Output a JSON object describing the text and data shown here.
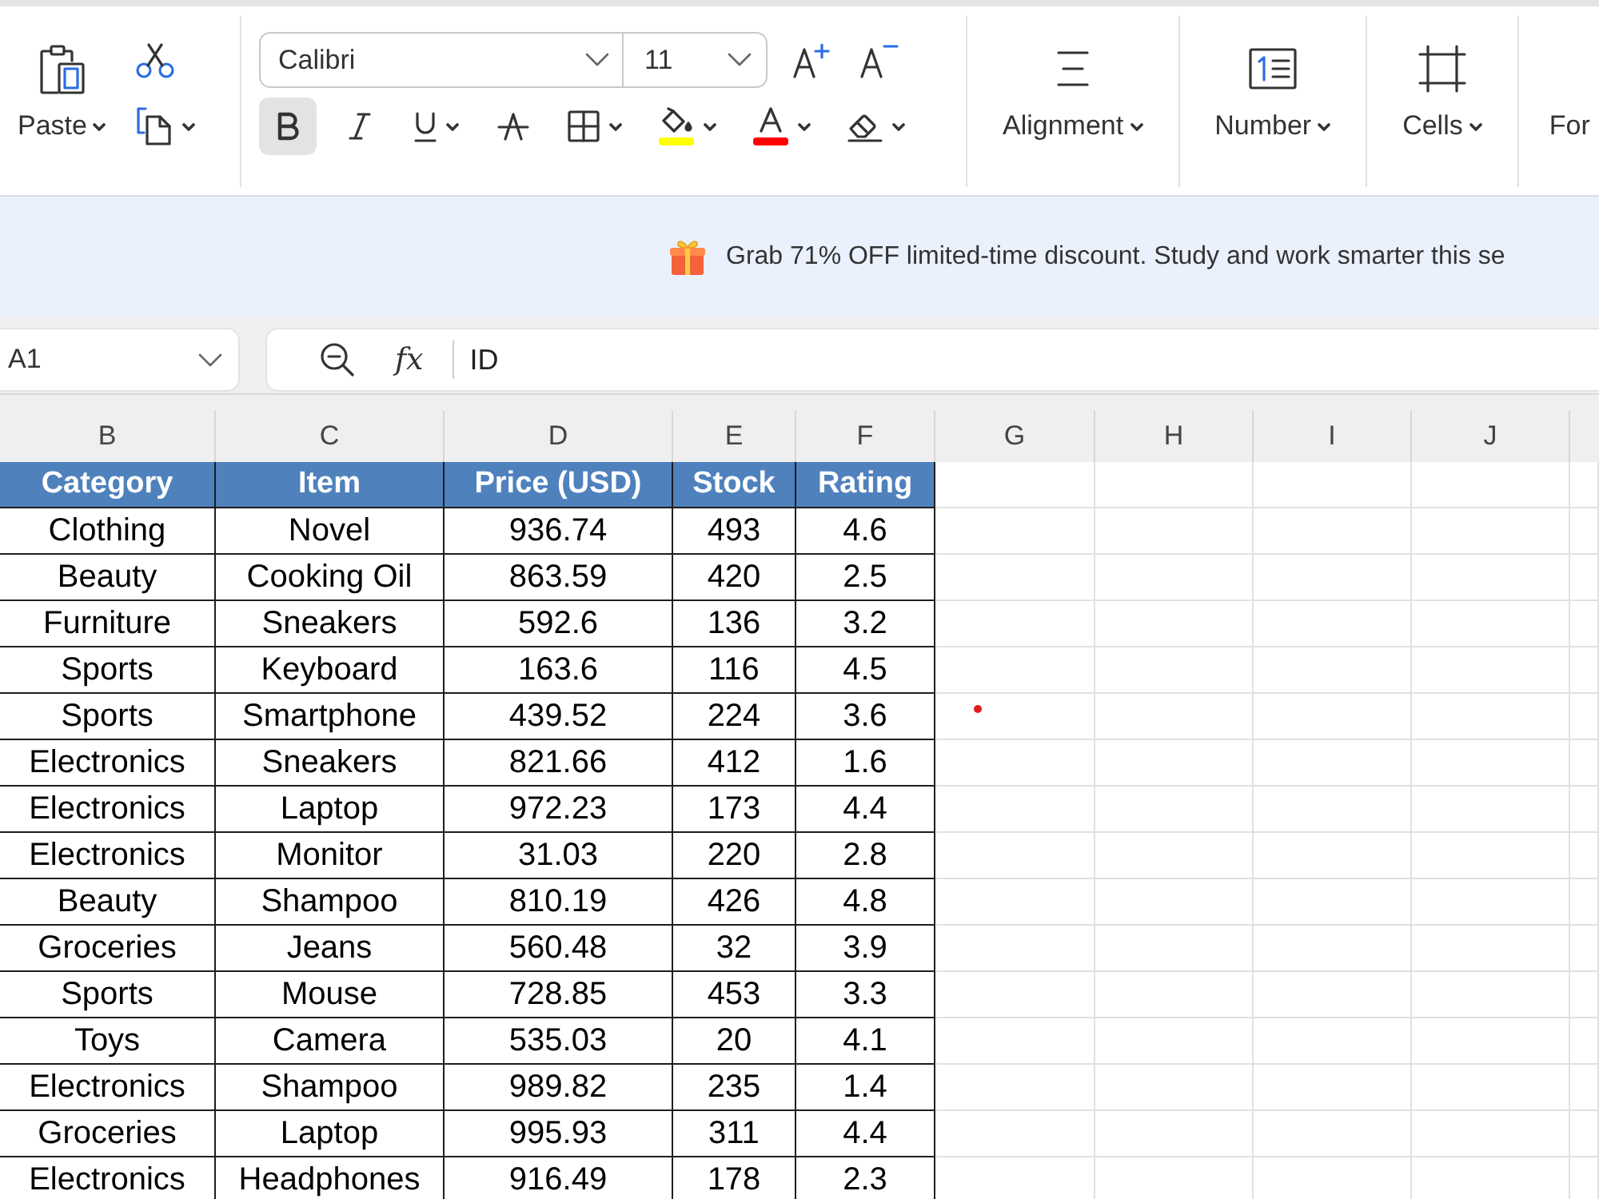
{
  "ribbon": {
    "clipboard": {
      "paste": {
        "label": "Paste",
        "dropdown": true
      },
      "copy": {
        "dropdown": true
      }
    },
    "font": {
      "font_name": "Calibri",
      "font_size": "11",
      "tools": [
        {
          "kind": "bold",
          "selected": true,
          "dropdown": false
        },
        {
          "kind": "italic",
          "selected": false,
          "dropdown": false
        },
        {
          "kind": "underline",
          "selected": false,
          "dropdown": true
        },
        {
          "kind": "strikethrough",
          "selected": false,
          "dropdown": false
        },
        {
          "kind": "borders",
          "selected": false,
          "dropdown": true
        },
        {
          "kind": "fill_color",
          "selected": false,
          "dropdown": true,
          "color": "#ffff00"
        },
        {
          "kind": "font_color",
          "selected": false,
          "dropdown": true,
          "color": "#ff0000"
        },
        {
          "kind": "clear",
          "selected": false,
          "dropdown": true
        }
      ]
    },
    "groups": [
      {
        "kind": "alignment",
        "label": "Alignment",
        "dropdown": true
      },
      {
        "kind": "number",
        "label": "Number",
        "dropdown": true
      },
      {
        "kind": "cells",
        "label": "Cells",
        "dropdown": true
      },
      {
        "kind": "partial",
        "label": "For"
      }
    ]
  },
  "banner": {
    "text": "Grab 71% OFF limited-time discount. Study and work smarter this se"
  },
  "formula_bar": {
    "name_box": "A1",
    "function_button": "fx",
    "content": "ID"
  },
  "sheet": {
    "column_letters": [
      "B",
      "C",
      "D",
      "E",
      "F",
      "G",
      "H",
      "I",
      "J"
    ],
    "table": {
      "headers": [
        "Category",
        "Item",
        "Price (USD)",
        "Stock",
        "Rating"
      ],
      "rows": [
        [
          "Clothing",
          "Novel",
          "936.74",
          "493",
          "4.6"
        ],
        [
          "Beauty",
          "Cooking Oil",
          "863.59",
          "420",
          "2.5"
        ],
        [
          "Furniture",
          "Sneakers",
          "592.6",
          "136",
          "3.2"
        ],
        [
          "Sports",
          "Keyboard",
          "163.6",
          "116",
          "4.5"
        ],
        [
          "Sports",
          "Smartphone",
          "439.52",
          "224",
          "3.6"
        ],
        [
          "Electronics",
          "Sneakers",
          "821.66",
          "412",
          "1.6"
        ],
        [
          "Electronics",
          "Laptop",
          "972.23",
          "173",
          "4.4"
        ],
        [
          "Electronics",
          "Monitor",
          "31.03",
          "220",
          "2.8"
        ],
        [
          "Beauty",
          "Shampoo",
          "810.19",
          "426",
          "4.8"
        ],
        [
          "Groceries",
          "Jeans",
          "560.48",
          "32",
          "3.9"
        ],
        [
          "Sports",
          "Mouse",
          "728.85",
          "453",
          "3.3"
        ],
        [
          "Toys",
          "Camera",
          "535.03",
          "20",
          "4.1"
        ],
        [
          "Electronics",
          "Shampoo",
          "989.82",
          "235",
          "1.4"
        ],
        [
          "Groceries",
          "Laptop",
          "995.93",
          "311",
          "4.4"
        ],
        [
          "Electronics",
          "Headphones",
          "916.49",
          "178",
          "2.3"
        ]
      ]
    }
  }
}
